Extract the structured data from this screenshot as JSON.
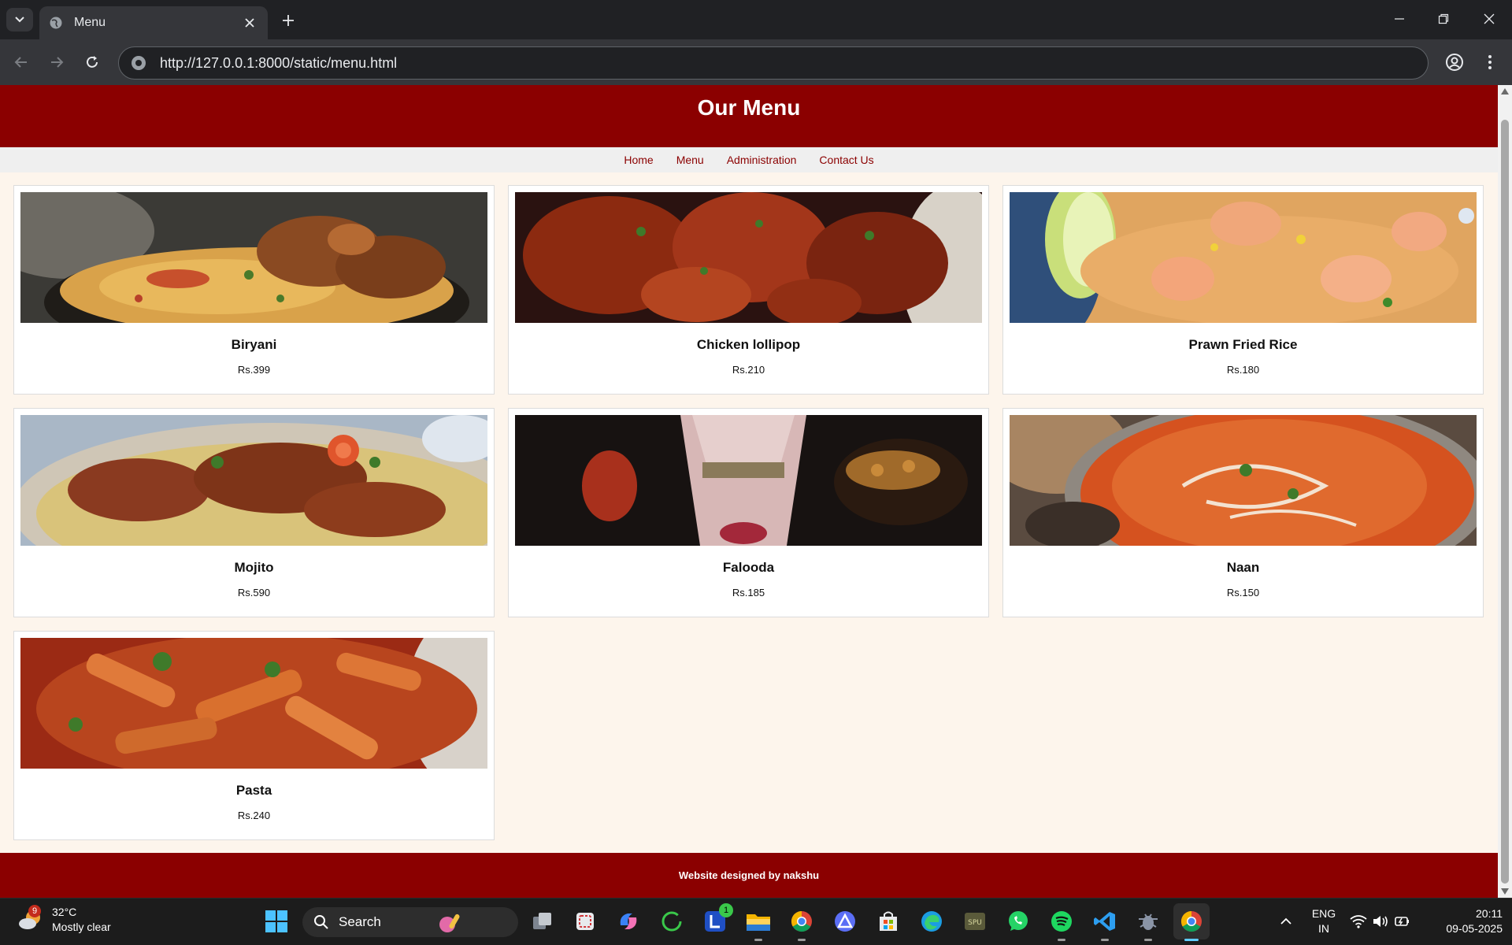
{
  "browser": {
    "tab_title": "Menu",
    "url": "http://127.0.0.1:8000/static/menu.html"
  },
  "page": {
    "title": "Our Menu",
    "nav": [
      "Home",
      "Menu",
      "Administration",
      "Contact Us"
    ],
    "items": [
      {
        "name": "Biryani",
        "price": "Rs.399"
      },
      {
        "name": "Chicken lollipop",
        "price": "Rs.210"
      },
      {
        "name": "Prawn Fried Rice",
        "price": "Rs.180"
      },
      {
        "name": "Mojito",
        "price": "Rs.590"
      },
      {
        "name": "Falooda",
        "price": "Rs.185"
      },
      {
        "name": "Naan",
        "price": "Rs.150"
      },
      {
        "name": "Pasta",
        "price": "Rs.240"
      }
    ],
    "footer": "Website designed by nakshu"
  },
  "taskbar": {
    "weather_badge": "9",
    "temperature": "32°C",
    "condition": "Mostly clear",
    "search_label": "Search",
    "vscode_badge": "1",
    "lang_line1": "ENG",
    "lang_line2": "IN",
    "time": "20:11",
    "date": "09-05-2025"
  },
  "colors": {
    "brand": "#8b0000",
    "page_background": "#fdf5ec",
    "chrome_dark": "#202124"
  }
}
